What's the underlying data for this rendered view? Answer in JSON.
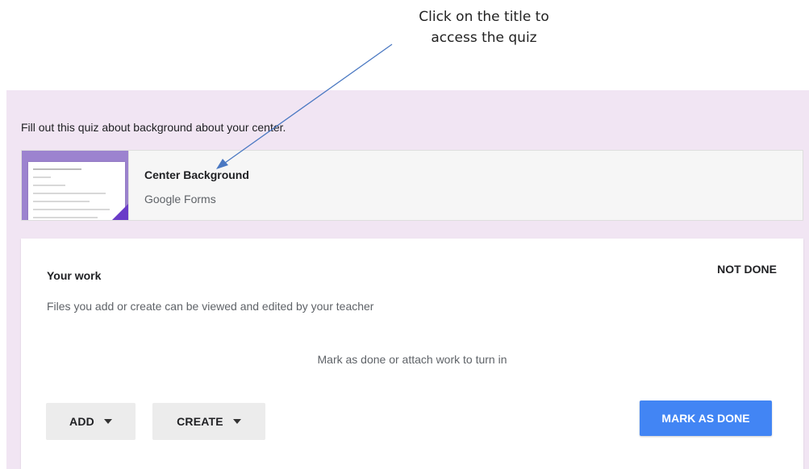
{
  "callout": {
    "line1": "Click on the title to",
    "line2": "access the quiz"
  },
  "assignment": {
    "description": "Fill out this quiz about background about your center."
  },
  "attachment": {
    "title": "Center Background",
    "type": "Google Forms",
    "icon": "google-forms-thumbnail",
    "thumb_color": "#9c83cf",
    "thumb_accent": "#6a3cc8"
  },
  "your_work": {
    "title": "Your work",
    "status": "NOT DONE",
    "note": "Files you add or create can be viewed and edited by your teacher",
    "hint": "Mark as done or attach work to turn in",
    "add_label": "ADD",
    "create_label": "CREATE",
    "mark_done_label": "MARK AS DONE",
    "accent_color": "#4285f4"
  },
  "colors": {
    "panel_background": "#f1e5f3",
    "arrow": "#4a78c2"
  }
}
